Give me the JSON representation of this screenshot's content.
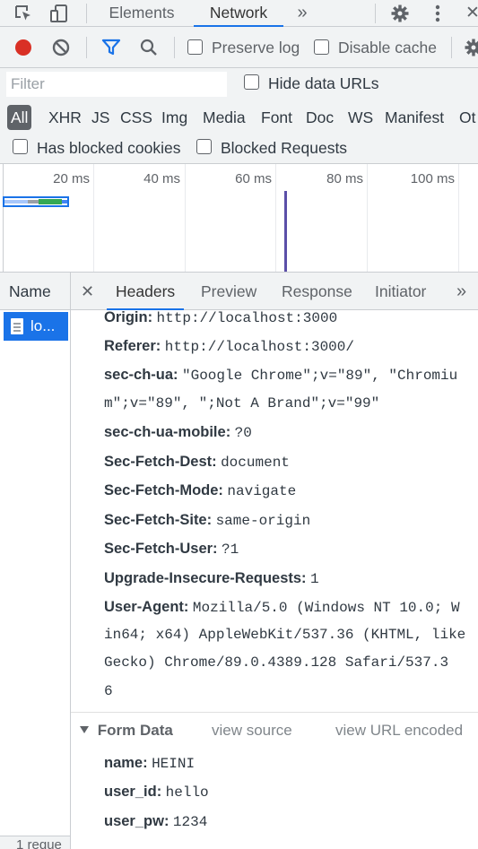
{
  "devtools": {
    "tabs": [
      {
        "label": "Elements"
      },
      {
        "label": "Network"
      }
    ],
    "more_tabs_glyph": "»",
    "close_glyph": "✕"
  },
  "toolbar": {
    "preserve_log": "Preserve log",
    "disable_cache": "Disable cache",
    "record_color": "#d93025",
    "filter_color": "#1a73e8"
  },
  "filter": {
    "placeholder": "Filter",
    "hide_data_urls": "Hide data URLs",
    "types": [
      "All",
      "XHR",
      "JS",
      "CSS",
      "Img",
      "Media",
      "Font",
      "Doc",
      "WS",
      "Manifest",
      "Ot"
    ],
    "has_blocked_cookies": "Has blocked cookies",
    "blocked_requests": "Blocked Requests"
  },
  "overview": {
    "ticks": [
      "20 ms",
      "40 ms",
      "60 ms",
      "80 ms",
      "100 ms"
    ]
  },
  "requests": {
    "column_header": "Name",
    "items": [
      {
        "name": "lo..."
      }
    ],
    "status": "1 reque"
  },
  "details": {
    "close_glyph": "✕",
    "tabs": [
      "Headers",
      "Preview",
      "Response",
      "Initiator"
    ],
    "more_glyph": "»",
    "headers": [
      {
        "key": "Origin:",
        "value": "http://localhost:3000"
      },
      {
        "key": "Referer:",
        "value": "http://localhost:3000/"
      },
      {
        "key": "sec-ch-ua:",
        "value": "\"Google Chrome\";v=\"89\", \"Chromiu",
        "cont": [
          "m\";v=\"89\", \";Not A Brand\";v=\"99\""
        ]
      },
      {
        "key": "sec-ch-ua-mobile:",
        "value": "?0"
      },
      {
        "key": "Sec-Fetch-Dest:",
        "value": "document"
      },
      {
        "key": "Sec-Fetch-Mode:",
        "value": "navigate"
      },
      {
        "key": "Sec-Fetch-Site:",
        "value": "same-origin"
      },
      {
        "key": "Sec-Fetch-User:",
        "value": "?1"
      },
      {
        "key": "Upgrade-Insecure-Requests:",
        "value": "1"
      },
      {
        "key": "User-Agent:",
        "value": "Mozilla/5.0 (Windows NT 10.0; W",
        "cont": [
          "in64; x64) AppleWebKit/537.36 (KHTML, like",
          "Gecko) Chrome/89.0.4389.128 Safari/537.3",
          "6"
        ]
      }
    ],
    "form_data": {
      "title": "Form Data",
      "view_source": "view source",
      "view_url_encoded": "view URL encoded",
      "fields": [
        {
          "key": "name:",
          "value": "HEINI"
        },
        {
          "key": "user_id:",
          "value": "hello"
        },
        {
          "key": "user_pw:",
          "value": "1234"
        }
      ]
    }
  }
}
